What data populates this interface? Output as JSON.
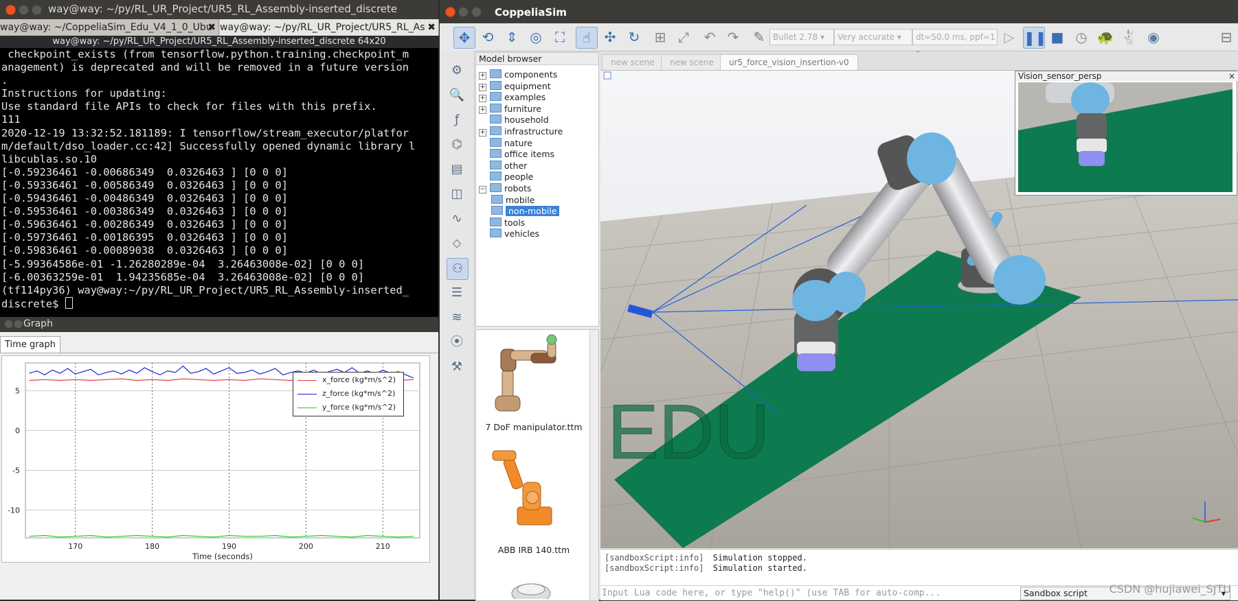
{
  "terminal": {
    "window_title": "way@way: ~/py/RL_UR_Project/UR5_RL_Assembly-inserted_discrete",
    "tabs": [
      {
        "label": "way@way: ~/CoppeliaSim_Edu_V4_1_0_Ubu"
      },
      {
        "label": "way@way: ~/py/RL_UR_Project/UR5_RL_As"
      }
    ],
    "subtitle": "way@way: ~/py/RL_UR_Project/UR5_RL_Assembly-inserted_discrete 64x20",
    "lines": [
      " checkpoint_exists (from tensorflow.python.training.checkpoint_m",
      "anagement) is deprecated and will be removed in a future version",
      ".",
      "Instructions for updating:",
      "Use standard file APIs to check for files with this prefix.",
      "111",
      "2020-12-19 13:32:52.181189: I tensorflow/stream_executor/platfor",
      "m/default/dso_loader.cc:42] Successfully opened dynamic library l",
      "libcublas.so.10",
      "[-0.59236461 -0.00686349  0.0326463 ] [0 0 0]",
      "[-0.59336461 -0.00586349  0.0326463 ] [0 0 0]",
      "[-0.59436461 -0.00486349  0.0326463 ] [0 0 0]",
      "[-0.59536461 -0.00386349  0.0326463 ] [0 0 0]",
      "[-0.59636461 -0.00286349  0.0326463 ] [0 0 0]",
      "[-0.59736461 -0.00186395  0.0326463 ] [0 0 0]",
      "[-0.59836461 -0.00089038  0.0326463 ] [0 0 0]",
      "[-5.99364586e-01 -1.26280289e-04  3.26463008e-02] [0 0 0]",
      "[-6.00363259e-01  1.94235685e-04  3.26463008e-02] [0 0 0]",
      "(tf114py36) way@way:~/py/RL_UR_Project/UR5_RL_Assembly-inserted_",
      "discrete$ "
    ]
  },
  "graph": {
    "title": "Graph",
    "tab": "Time graph",
    "colors": {
      "x_force": "#e8383d",
      "z_force": "#2020d0",
      "y_force": "#22cc22"
    }
  },
  "chart_data": {
    "type": "line",
    "xlabel": "Time (seconds)",
    "ylabel": "",
    "xlim": [
      163.5,
      214.8
    ],
    "ylim": [
      -13.5,
      8.5
    ],
    "xticks": [
      170,
      180,
      190,
      200,
      210
    ],
    "yticks": [
      5,
      0,
      -5,
      -10
    ],
    "grid": true,
    "legend_position": "top-right",
    "series": [
      {
        "name": "x_force (kg*m/s^2)",
        "x": [
          164,
          166,
          168,
          170,
          172,
          174,
          176,
          178,
          180,
          182,
          184,
          186,
          188,
          190,
          192,
          194,
          196,
          198,
          200,
          202,
          204,
          206,
          208,
          210,
          212,
          214
        ],
        "values": [
          6.3,
          6.4,
          6.3,
          6.4,
          6.3,
          6.4,
          6.5,
          6.3,
          6.4,
          6.3,
          6.5,
          6.4,
          6.3,
          6.4,
          6.3,
          6.5,
          6.4,
          6.3,
          6.4,
          6.5,
          6.3,
          6.4,
          6.3,
          6.4,
          6.3,
          6.4
        ]
      },
      {
        "name": "z_force (kg*m/s^2)",
        "x": [
          164,
          165,
          166,
          167,
          168,
          169,
          170,
          171,
          172,
          173,
          174,
          175,
          176,
          177,
          178,
          179,
          180,
          181,
          182,
          183,
          184,
          185,
          186,
          187,
          188,
          189,
          190,
          191,
          192,
          193,
          194,
          195,
          196,
          197,
          198,
          199,
          200,
          201,
          202,
          203,
          204,
          205,
          206,
          207,
          208,
          209,
          210,
          211,
          212,
          213,
          214
        ],
        "values": [
          7.2,
          7.5,
          7.0,
          7.6,
          7.2,
          7.8,
          7.1,
          7.4,
          7.7,
          7.0,
          7.3,
          7.5,
          7.1,
          7.6,
          7.2,
          7.9,
          7.4,
          7.0,
          7.5,
          7.3,
          8.1,
          7.2,
          7.4,
          7.8,
          7.1,
          7.5,
          7.9,
          7.2,
          7.3,
          7.6,
          7.1,
          7.4,
          7.8,
          7.0,
          7.3,
          7.5,
          7.2,
          7.6,
          7.1,
          7.4,
          7.7,
          7.3,
          7.9,
          7.2,
          7.5,
          7.1,
          7.6,
          7.2,
          7.4,
          7.0,
          6.6
        ]
      },
      {
        "name": "y_force (kg*m/s^2)",
        "x": [
          164,
          166,
          168,
          170,
          172,
          174,
          176,
          178,
          180,
          182,
          184,
          186,
          188,
          190,
          192,
          194,
          196,
          198,
          200,
          202,
          204,
          206,
          208,
          210,
          212,
          214
        ],
        "values": [
          -13.3,
          -13.2,
          -13.4,
          -13.3,
          -13.2,
          -13.4,
          -13.3,
          -13.2,
          -13.3,
          -13.4,
          -13.2,
          -13.3,
          -13.4,
          -13.2,
          -13.3,
          -13.3,
          -13.2,
          -13.4,
          -13.3,
          -13.2,
          -13.3,
          -13.4,
          -13.2,
          -13.3,
          -13.4,
          -13.3
        ]
      }
    ]
  },
  "coppelia": {
    "window_title": "CoppeliaSim",
    "toolbar": {
      "engine": "Bullet 2.78",
      "accuracy": "Very accurate",
      "timestep": "dt=50.0 ms, ppf=1"
    },
    "model_browser": {
      "header": "Model browser",
      "items": [
        {
          "label": "components",
          "expandable": true
        },
        {
          "label": "equipment",
          "expandable": true
        },
        {
          "label": "examples",
          "expandable": true
        },
        {
          "label": "furniture",
          "expandable": true
        },
        {
          "label": "household",
          "expandable": false
        },
        {
          "label": "infrastructure",
          "expandable": true
        },
        {
          "label": "nature",
          "expandable": false
        },
        {
          "label": "office items",
          "expandable": false
        },
        {
          "label": "other",
          "expandable": false
        },
        {
          "label": "people",
          "expandable": false
        },
        {
          "label": "robots",
          "expandable": true,
          "expanded": true
        },
        {
          "label": "mobile",
          "expandable": false,
          "child": true
        },
        {
          "label": "non-mobile",
          "expandable": false,
          "child": true,
          "selected": true
        },
        {
          "label": "tools",
          "expandable": false
        },
        {
          "label": "vehicles",
          "expandable": false
        }
      ],
      "thumbnails": [
        {
          "label": "7 DoF manipulator.ttm"
        },
        {
          "label": "ABB IRB 140.ttm"
        }
      ]
    },
    "scene_tabs": [
      {
        "label": "new scene"
      },
      {
        "label": "new scene"
      },
      {
        "label": "ur5_force_vision_insertion-v0",
        "active": true
      }
    ],
    "vision_sensor_title": "Vision_sensor_persp",
    "edu_watermark": "EDU",
    "console": [
      {
        "source": "[sandboxScript:info]",
        "message": "Simulation stopped."
      },
      {
        "source": "[sandboxScript:info]",
        "message": "Simulation started."
      }
    ],
    "input_placeholder": "Input Lua code here, or type \"help()\" (use TAB for auto-comp...",
    "script_selector": "Sandbox script"
  },
  "watermark": "CSDN @hujiawei_SJTU"
}
